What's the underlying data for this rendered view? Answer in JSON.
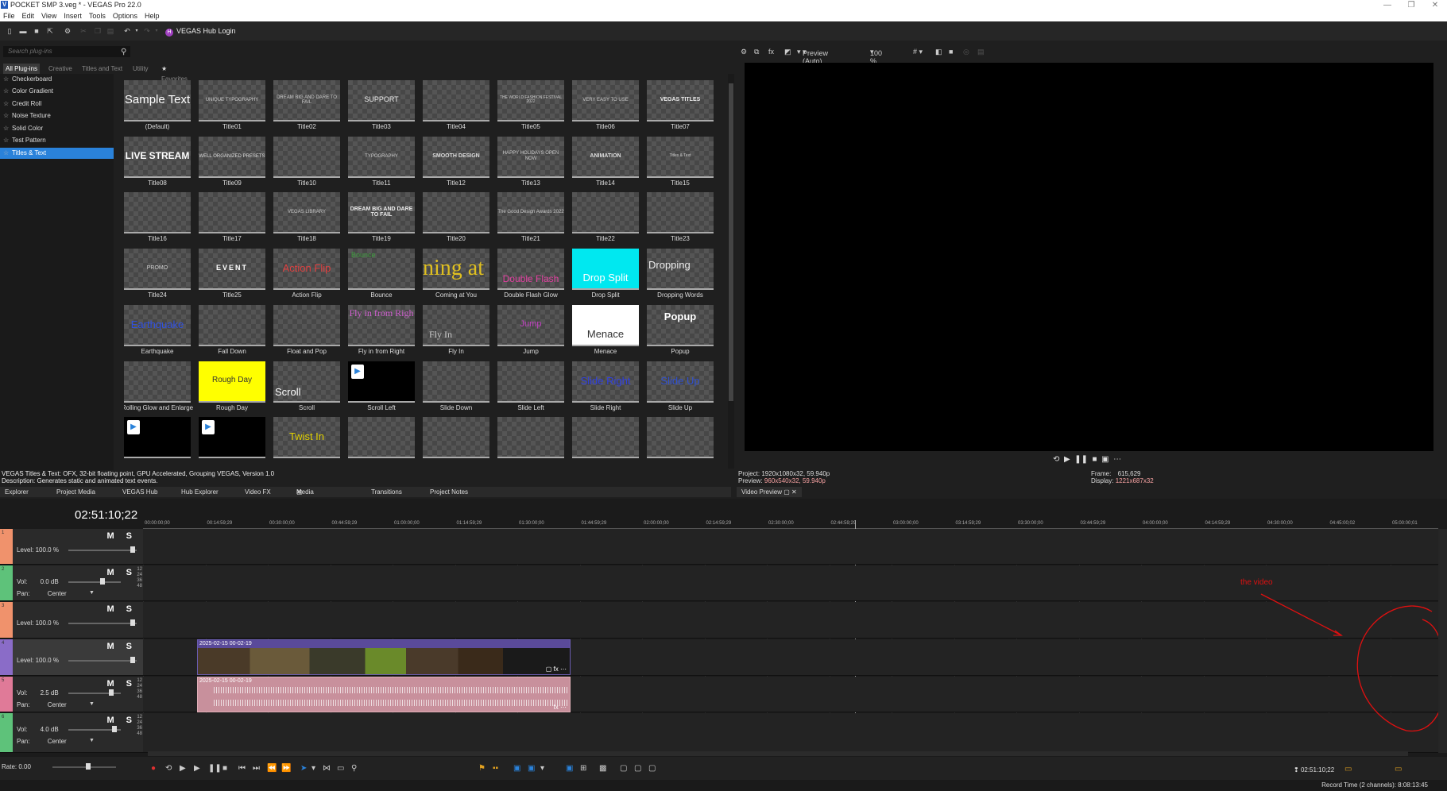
{
  "window": {
    "title": "POCKET SMP 3.veg * - VEGAS Pro 22.0",
    "logo": "V",
    "controls": [
      "—",
      "❐",
      "✕"
    ]
  },
  "menu": [
    "File",
    "Edit",
    "View",
    "Insert",
    "Tools",
    "Options",
    "Help"
  ],
  "toolbar": {
    "hub_label": "VEGAS Hub Login",
    "hub_icon": "H"
  },
  "plugins": {
    "search_placeholder": "Search plug-ins",
    "tabs": [
      "All Plug-ins",
      "Creative",
      "Titles and Text",
      "Utility",
      "Favorites"
    ],
    "list": [
      "Checkerboard",
      "Color Gradient",
      "Credit Roll",
      "Noise Texture",
      "Solid Color",
      "Test Pattern",
      "Titles & Text"
    ],
    "selected_index": 6,
    "presets": [
      {
        "name": "(Default)",
        "thumb": "Sample Text"
      },
      {
        "name": "Title01",
        "thumb": "UNIQUE TYPOGRAPHY"
      },
      {
        "name": "Title02",
        "thumb": "DREAM BIG AND DARE TO FAIL"
      },
      {
        "name": "Title03",
        "thumb": "SUPPORT"
      },
      {
        "name": "Title04",
        "thumb": ""
      },
      {
        "name": "Title05",
        "thumb": "THE WORLD FASHION FESTIVAL 2022"
      },
      {
        "name": "Title06",
        "thumb": "VERY EASY TO USE"
      },
      {
        "name": "Title07",
        "thumb": "VEGAS TITLES"
      },
      {
        "name": "Title08",
        "thumb": "LIVE STREAM"
      },
      {
        "name": "Title09",
        "thumb": "WELL ORGANIZED PRESETS"
      },
      {
        "name": "Title10",
        "thumb": ""
      },
      {
        "name": "Title11",
        "thumb": "TYPOGRAPHY"
      },
      {
        "name": "Title12",
        "thumb": "SMOOTH DESIGN"
      },
      {
        "name": "Title13",
        "thumb": "HAPPY HOLIDAYS OPEN NOW"
      },
      {
        "name": "Title14",
        "thumb": "ANIMATION"
      },
      {
        "name": "Title15",
        "thumb": "Titles & Text"
      },
      {
        "name": "Title16",
        "thumb": ""
      },
      {
        "name": "Title17",
        "thumb": ""
      },
      {
        "name": "Title18",
        "thumb": "VEGAS LIBRARY"
      },
      {
        "name": "Title19",
        "thumb": "DREAM BIG AND DARE TO FAIL"
      },
      {
        "name": "Title20",
        "thumb": ""
      },
      {
        "name": "Title21",
        "thumb": "The Good Design Awards 2022"
      },
      {
        "name": "Title22",
        "thumb": ""
      },
      {
        "name": "Title23",
        "thumb": ""
      },
      {
        "name": "Title24",
        "thumb": "PROMO"
      },
      {
        "name": "Title25",
        "thumb": "EVENT"
      },
      {
        "name": "Action Flip",
        "thumb": "Action Flip"
      },
      {
        "name": "Bounce",
        "thumb": "Bounce"
      },
      {
        "name": "Coming at You",
        "thumb": "ning at"
      },
      {
        "name": "Double Flash Glow",
        "thumb": "Double Flash"
      },
      {
        "name": "Drop Split",
        "thumb": "Drop Split"
      },
      {
        "name": "Dropping Words",
        "thumb": "Dropping"
      },
      {
        "name": "Earthquake",
        "thumb": "Earthquake"
      },
      {
        "name": "Fall Down",
        "thumb": ""
      },
      {
        "name": "Float and Pop",
        "thumb": ""
      },
      {
        "name": "Fly in from Right",
        "thumb": "Fly in from Righ"
      },
      {
        "name": "Fly In",
        "thumb": "Fly In"
      },
      {
        "name": "Jump",
        "thumb": "Jump"
      },
      {
        "name": "Menace",
        "thumb": "Menace"
      },
      {
        "name": "Popup",
        "thumb": "Popup"
      },
      {
        "name": "Rolling Glow and Enlarge",
        "thumb": ""
      },
      {
        "name": "Rough Day",
        "thumb": "Rough Day"
      },
      {
        "name": "Scroll",
        "thumb": "Scroll"
      },
      {
        "name": "Scroll Left",
        "thumb": ""
      },
      {
        "name": "Slide Down",
        "thumb": ""
      },
      {
        "name": "Slide Left",
        "thumb": ""
      },
      {
        "name": "Slide Right",
        "thumb": "Slide Right"
      },
      {
        "name": "Slide Up",
        "thumb": "Slide Up"
      },
      {
        "name": "",
        "thumb": ""
      },
      {
        "name": "",
        "thumb": ""
      },
      {
        "name": "",
        "thumb": "Twist In"
      },
      {
        "name": "",
        "thumb": ""
      },
      {
        "name": "",
        "thumb": ""
      },
      {
        "name": "",
        "thumb": ""
      },
      {
        "name": "",
        "thumb": ""
      },
      {
        "name": "",
        "thumb": ""
      }
    ],
    "description_line1": "VEGAS Titles & Text: OFX, 32-bit floating point, GPU Accelerated, Grouping VEGAS, Version 1.0",
    "description_line2": "Description: Generates static and animated text events."
  },
  "dock_tabs": [
    "Explorer",
    "Project Media",
    "VEGAS Hub",
    "Hub Explorer",
    "Video FX",
    "Media Generator",
    "Transitions",
    "Project Notes"
  ],
  "dock_active": "Media Generator",
  "preview": {
    "mode": "Preview (Auto)",
    "zoom": "100 %",
    "project_label": "Project:",
    "project_value": "1920x1080x32, 59.940p",
    "preview_label": "Preview:",
    "preview_value": "960x540x32, 59.940p",
    "frame_label": "Frame:",
    "frame_value": "615,629",
    "display_label": "Display:",
    "display_value": "1221x687x32",
    "tab": "Video Preview"
  },
  "timeline": {
    "timecode": "02:51:10;22",
    "ruler": [
      "00:00:00;00",
      "00:14:59;29",
      "00:30:00;00",
      "00:44:59;29",
      "01:00:00;00",
      "01:14:59;29",
      "01:30:00;00",
      "01:44:59;29",
      "02:00:00;00",
      "02:14:59;29",
      "02:30:00;00",
      "02:44:59;29",
      "03:00:00;00",
      "03:14:59;29",
      "03:30:00;00",
      "03:44:59;29",
      "04:00:00;00",
      "04:14:59;29",
      "04:30:00;00",
      "04:45:00;02",
      "05:00:00;01"
    ],
    "tracks": [
      {
        "type": "video",
        "num": "1",
        "label": "Level:",
        "value": "100.0 %",
        "color": "#f0926c"
      },
      {
        "type": "audio",
        "num": "2",
        "vol": "0.0 dB",
        "pan": "Center",
        "color": "#5ec27a"
      },
      {
        "type": "video",
        "num": "3",
        "label": "Level:",
        "value": "100.0 %",
        "color": "#f0926c"
      },
      {
        "type": "video",
        "num": "4",
        "label": "Level:",
        "value": "100.0 %",
        "color": "#8a6cc8"
      },
      {
        "type": "audio",
        "num": "5",
        "vol": "2.5 dB",
        "pan": "Center",
        "color": "#e07a98"
      },
      {
        "type": "audio",
        "num": "6",
        "vol": "4.0 dB",
        "pan": "Center",
        "color": "#5ec27a"
      }
    ],
    "vol_label": "Vol:",
    "pan_label": "Pan:",
    "ms": "M S",
    "scale": [
      "12",
      "24",
      "36",
      "48"
    ],
    "clip_video_label": "2025-02-15 00-02-19",
    "clip_audio_label": "2025-02-15 00-02-19",
    "annotation": "the video",
    "rate": "Rate: 0.00",
    "end_timecode": "02:51:10;22",
    "record_time": "Record Time (2 channels): 8:08:13:45"
  }
}
